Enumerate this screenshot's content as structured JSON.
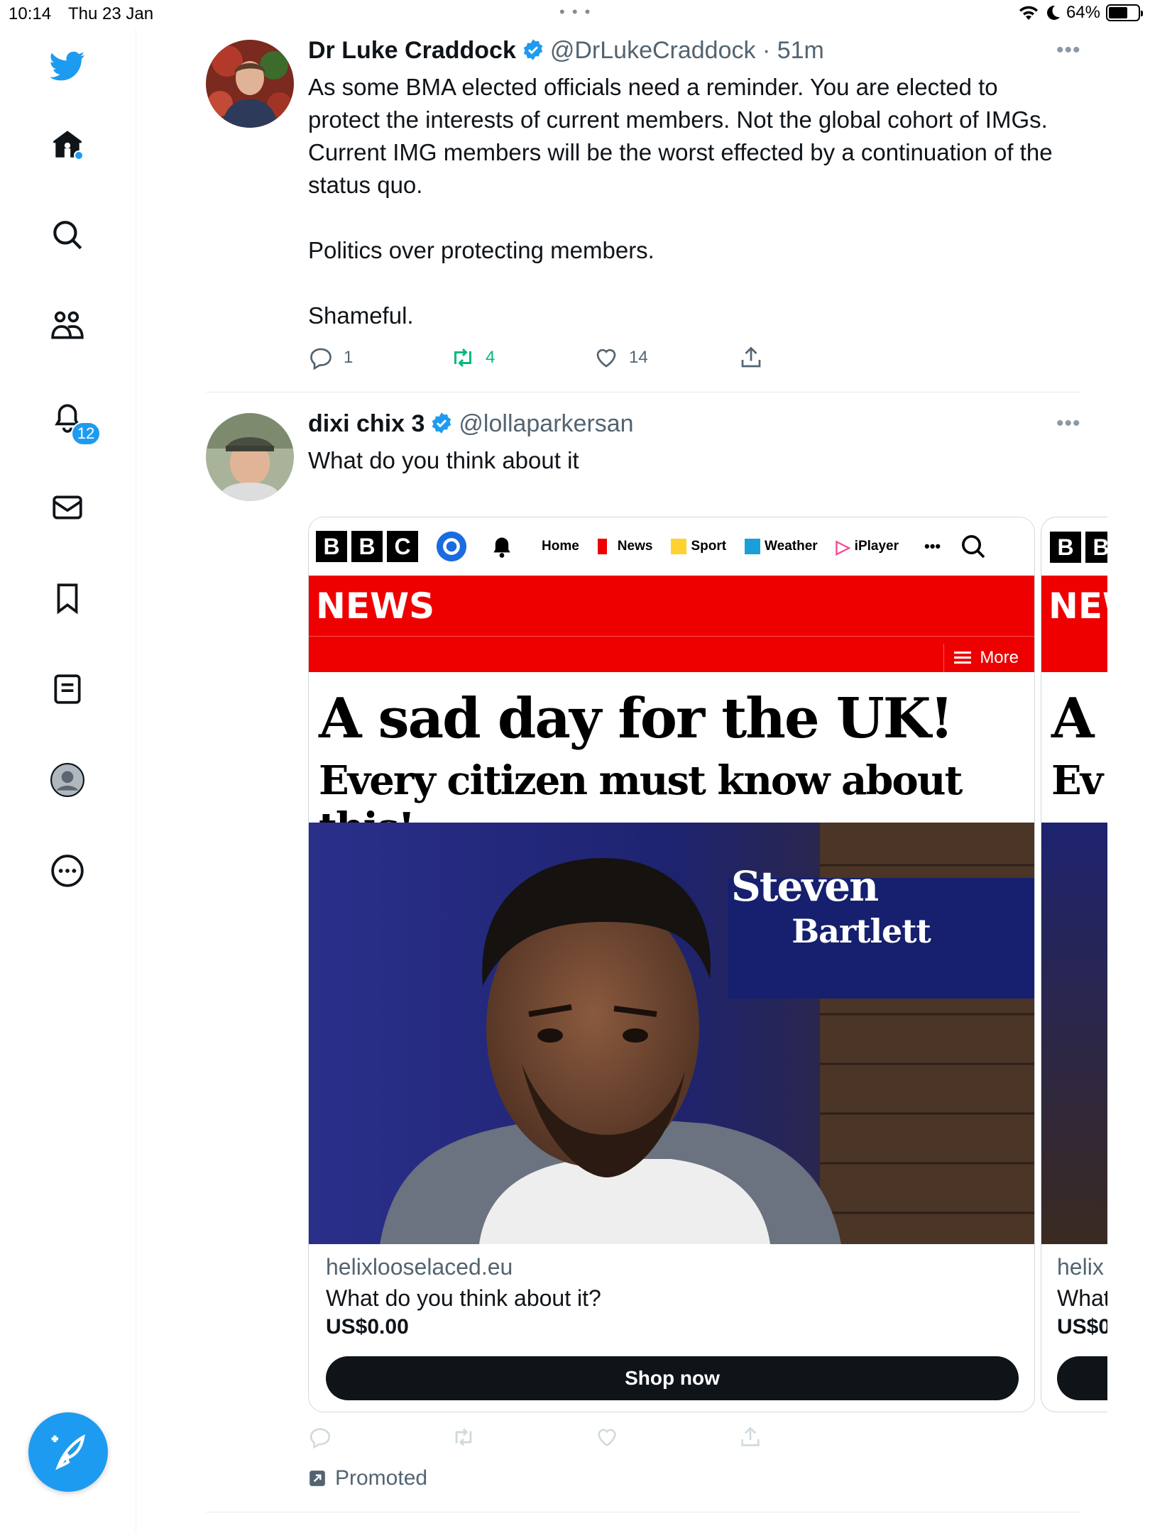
{
  "status_bar": {
    "time": "10:14",
    "date": "Thu 23 Jan",
    "battery": "64%",
    "battery_level": 0.64
  },
  "sidebar": {
    "items": [
      {
        "icon": "twitter-logo-icon"
      },
      {
        "icon": "home-icon"
      },
      {
        "icon": "search-icon"
      },
      {
        "icon": "communities-icon"
      },
      {
        "icon": "notifications-icon",
        "badge": "12"
      },
      {
        "icon": "messages-icon"
      },
      {
        "icon": "bookmarks-icon"
      },
      {
        "icon": "lists-icon"
      },
      {
        "icon": "profile-icon"
      },
      {
        "icon": "more-options-icon"
      }
    ],
    "compose_icon": "compose-tweet-icon"
  },
  "tweet1": {
    "name": "Dr Luke Craddock",
    "handle": "@DrLukeCraddock",
    "time": "· 51m",
    "text": "As some BMA elected officials need a reminder. You are elected to protect the interests of current members. Not the global cohort of IMGs. Current IMG members will be the worst effected by a continuation of the status quo.\n\nPolitics over protecting members.\n\nShameful.",
    "replies": "1",
    "retweets": "4",
    "likes": "14"
  },
  "tweet2": {
    "name": "dixi chix 3",
    "handle": "@lollaparkersan",
    "text": "What do you think about it",
    "card": {
      "bbc_letters": [
        "B",
        "B",
        "C"
      ],
      "nav": [
        "Home",
        "News",
        "Sport",
        "Weather",
        "iPlayer"
      ],
      "news_label": "NEWS",
      "more_label": "More",
      "headline": "A sad day for the UK!",
      "subheadline": "Every citizen must know about this!",
      "overlay_first": "Steven",
      "overlay_last": "Bartlett",
      "domain": "helixlooselaced.eu",
      "title": "What do you think about it?",
      "price": "US$0.00",
      "button": "Shop now"
    },
    "card_peek": {
      "bbc_letters": [
        "B",
        "B"
      ],
      "news_label": "NEW",
      "headline": "A",
      "subheadline": "Ev",
      "domain": "helix",
      "title": "What",
      "price": "US$0"
    },
    "promoted": "Promoted"
  },
  "colors": {
    "accent": "#1d9bf0",
    "retweet": "#00ba7c",
    "bbc_red": "#ee0000"
  }
}
